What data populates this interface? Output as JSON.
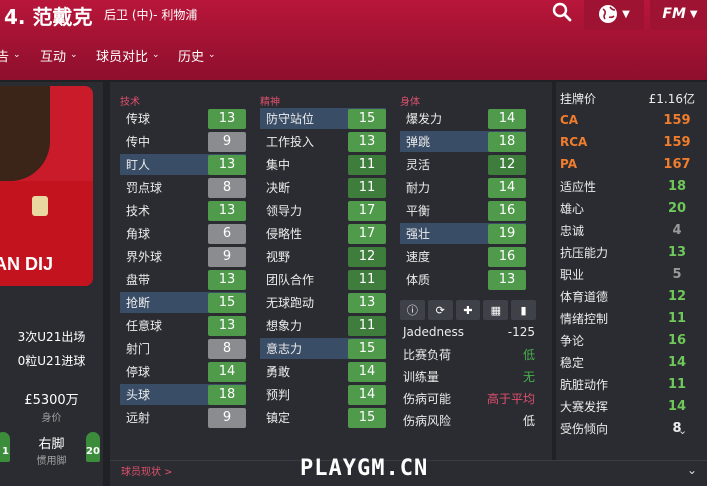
{
  "header": {
    "title": "4. 范戴克",
    "subtitle": "后卫 (中)- 利物浦",
    "menu": [
      "告",
      "互动",
      "球员对比",
      "历史"
    ]
  },
  "left": {
    "shirt_name": "AN DIJ",
    "u21_apps": "3次U21出场",
    "u21_goals": "0粒U21进球",
    "value": "£5300万",
    "value_label": "身价",
    "foot": "右脚",
    "foot_label": "惯用脚",
    "left_fig_num": "1",
    "right_fig_num": "20"
  },
  "columns": {
    "tech": "技术",
    "mental": "精神",
    "physical": "身体"
  },
  "technical": [
    {
      "name": "传球",
      "value": 13,
      "hl": false
    },
    {
      "name": "传中",
      "value": 9,
      "hl": false
    },
    {
      "name": "盯人",
      "value": 13,
      "hl": true
    },
    {
      "name": "罚点球",
      "value": 8,
      "hl": false
    },
    {
      "name": "技术",
      "value": 13,
      "hl": false
    },
    {
      "name": "角球",
      "value": 6,
      "hl": false
    },
    {
      "name": "界外球",
      "value": 9,
      "hl": false
    },
    {
      "name": "盘带",
      "value": 13,
      "hl": false
    },
    {
      "name": "抢断",
      "value": 15,
      "hl": true
    },
    {
      "name": "任意球",
      "value": 13,
      "hl": false
    },
    {
      "name": "射门",
      "value": 8,
      "hl": false
    },
    {
      "name": "停球",
      "value": 14,
      "hl": false
    },
    {
      "name": "头球",
      "value": 18,
      "hl": true
    },
    {
      "name": "远射",
      "value": 9,
      "hl": false
    }
  ],
  "mental": [
    {
      "name": "防守站位",
      "value": 15,
      "hl": true
    },
    {
      "name": "工作投入",
      "value": 13,
      "hl": false
    },
    {
      "name": "集中",
      "value": 11,
      "hl": false
    },
    {
      "name": "决断",
      "value": 11,
      "hl": false
    },
    {
      "name": "领导力",
      "value": 17,
      "hl": false
    },
    {
      "name": "侵略性",
      "value": 17,
      "hl": false
    },
    {
      "name": "视野",
      "value": 12,
      "hl": false
    },
    {
      "name": "团队合作",
      "value": 11,
      "hl": false
    },
    {
      "name": "无球跑动",
      "value": 13,
      "hl": false
    },
    {
      "name": "想象力",
      "value": 11,
      "hl": false
    },
    {
      "name": "意志力",
      "value": 15,
      "hl": true
    },
    {
      "name": "勇敢",
      "value": 14,
      "hl": false
    },
    {
      "name": "预判",
      "value": 14,
      "hl": false
    },
    {
      "name": "镇定",
      "value": 15,
      "hl": false
    }
  ],
  "physical": [
    {
      "name": "爆发力",
      "value": 14,
      "hl": false
    },
    {
      "name": "弹跳",
      "value": 18,
      "hl": true
    },
    {
      "name": "灵活",
      "value": 12,
      "hl": false
    },
    {
      "name": "耐力",
      "value": 14,
      "hl": false
    },
    {
      "name": "平衡",
      "value": 16,
      "hl": false
    },
    {
      "name": "强壮",
      "value": 19,
      "hl": true
    },
    {
      "name": "速度",
      "value": 16,
      "hl": false
    },
    {
      "name": "体质",
      "value": 13,
      "hl": false
    }
  ],
  "condition": [
    {
      "label": "Jadedness",
      "value": "-125",
      "color": "#ececec"
    },
    {
      "label": "比赛负荷",
      "value": "低",
      "color": "#48b04c"
    },
    {
      "label": "训练量",
      "value": "无",
      "color": "#48b04c"
    },
    {
      "label": "伤病可能",
      "value": "高于平均",
      "color": "#e0506d"
    },
    {
      "label": "伤病风险",
      "value": "低",
      "color": "#ececec"
    }
  ],
  "right": [
    {
      "label": "挂牌价",
      "value": "£1.16亿",
      "lcolor": "#ececec",
      "vcolor": "#ececec"
    },
    {
      "label": "CA",
      "value": "159",
      "lcolor": "#f07d2e",
      "vcolor": "#f07d2e"
    },
    {
      "label": "RCA",
      "value": "159",
      "lcolor": "#f07d2e",
      "vcolor": "#f07d2e"
    },
    {
      "label": "PA",
      "value": "167",
      "lcolor": "#f07d2e",
      "vcolor": "#f07d2e"
    },
    {
      "label": "适应性",
      "value": "18",
      "lcolor": "#ececec",
      "vcolor": "#6fc85a"
    },
    {
      "label": "雄心",
      "value": "20",
      "lcolor": "#ececec",
      "vcolor": "#6fc85a"
    },
    {
      "label": "忠诚",
      "value": "4",
      "lcolor": "#ececec",
      "vcolor": "#9a9a9a"
    },
    {
      "label": "抗压能力",
      "value": "13",
      "lcolor": "#ececec",
      "vcolor": "#6fc85a"
    },
    {
      "label": "职业",
      "value": "5",
      "lcolor": "#ececec",
      "vcolor": "#9a9a9a"
    },
    {
      "label": "体育道德",
      "value": "12",
      "lcolor": "#ececec",
      "vcolor": "#6fc85a"
    },
    {
      "label": "情绪控制",
      "value": "11",
      "lcolor": "#ececec",
      "vcolor": "#6fc85a"
    },
    {
      "label": "争论",
      "value": "16",
      "lcolor": "#ececec",
      "vcolor": "#6fc85a"
    },
    {
      "label": "稳定",
      "value": "14",
      "lcolor": "#ececec",
      "vcolor": "#6fc85a"
    },
    {
      "label": "肮脏动作",
      "value": "11",
      "lcolor": "#ececec",
      "vcolor": "#6fc85a"
    },
    {
      "label": "大赛发挥",
      "value": "14",
      "lcolor": "#ececec",
      "vcolor": "#6fc85a"
    },
    {
      "label": "受伤倾向",
      "value": "8",
      "lcolor": "#ececec",
      "vcolor": "#ececec"
    }
  ],
  "footer": {
    "link": "球员现状 >",
    "watermark": "PLAYGM.CN"
  },
  "colors": {
    "low": "#8a8c90",
    "mid": "#3f7d3d",
    "high": "#4f9a4b",
    "accent": "#b8163a"
  }
}
